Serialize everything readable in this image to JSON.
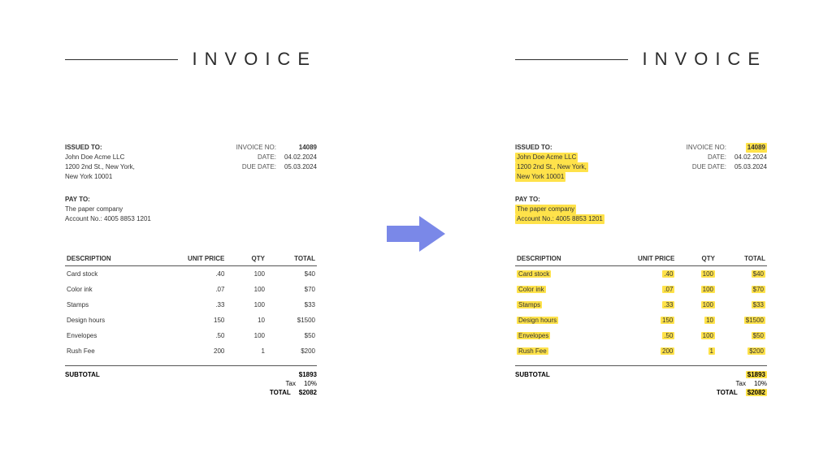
{
  "title": "INVOICE",
  "issued_to_label": "ISSUED TO:",
  "issued_to_name": "John Doe Acme LLC",
  "issued_to_addr1": "1200 2nd St., New York,",
  "issued_to_addr2": "New York 10001",
  "pay_to_label": "PAY TO:",
  "pay_to_name": "The paper company",
  "pay_to_acct": "Account No.: 4005 8853 1201",
  "invoice_no_label": "INVOICE NO:",
  "invoice_no": "14089",
  "date_label": "DATE:",
  "date": "04.02.2024",
  "due_date_label": "DUE DATE:",
  "due_date": "05.03.2024",
  "col_desc": "DESCRIPTION",
  "col_unit": "UNIT PRICE",
  "col_qty": "QTY",
  "col_total": "TOTAL",
  "rows": [
    {
      "desc": "Card stock",
      "unit": ".40",
      "qty": "100",
      "total": "$40"
    },
    {
      "desc": "Color ink",
      "unit": ".07",
      "qty": "100",
      "total": "$70"
    },
    {
      "desc": "Stamps",
      "unit": ".33",
      "qty": "100",
      "total": "$33"
    },
    {
      "desc": "Design hours",
      "unit": "150",
      "qty": "10",
      "total": "$1500"
    },
    {
      "desc": "Envelopes",
      "unit": ".50",
      "qty": "100",
      "total": "$50"
    },
    {
      "desc": "Rush Fee",
      "unit": "200",
      "qty": "1",
      "total": "$200"
    }
  ],
  "subtotal_label": "SUBTOTAL",
  "subtotal": "$1893",
  "tax_label": "Tax",
  "tax": "10%",
  "total_label": "TOTAL",
  "total": "$2082",
  "arrow_color": "#7a88e8"
}
